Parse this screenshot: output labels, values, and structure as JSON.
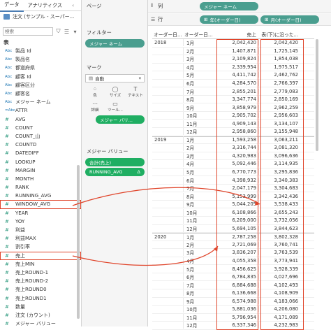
{
  "left": {
    "tabs": [
      "データ",
      "アナリティクス"
    ],
    "collapse": "‹",
    "datasource": "注文 (サンプル - スーパー...",
    "search_placeholder": "検索",
    "tables_title": "表",
    "fields": [
      {
        "type": "Abc",
        "name": "製品 Id"
      },
      {
        "type": "Abc",
        "name": "製品名"
      },
      {
        "type": "Abc",
        "name": "都道府県"
      },
      {
        "type": "Abc",
        "name": "顧客 Id"
      },
      {
        "type": "Abc",
        "name": "顧客区分"
      },
      {
        "type": "Abc",
        "name": "顧客名"
      },
      {
        "type": "Abc",
        "name": "メジャー ネーム"
      },
      {
        "type": "=Abc",
        "name": "ATTR"
      },
      {
        "type": "#",
        "name": "AVG"
      },
      {
        "type": "#",
        "name": "COUNT"
      },
      {
        "type": "#",
        "name": "COUNT_山"
      },
      {
        "type": "#",
        "name": "COUNTD"
      },
      {
        "type": "#",
        "name": "DATEDIFF"
      },
      {
        "type": "#",
        "name": "LOOKUP"
      },
      {
        "type": "#",
        "name": "MARGIN"
      },
      {
        "type": "#",
        "name": "MONTH"
      },
      {
        "type": "#",
        "name": "RANK"
      },
      {
        "type": "#",
        "name": "RUNNING_AVG"
      },
      {
        "type": "#",
        "name": "WINDOW_AVG",
        "highlight": true
      },
      {
        "type": "#",
        "name": "YEAR"
      },
      {
        "type": "#",
        "name": "YOY"
      },
      {
        "type": "#",
        "name": "利益"
      },
      {
        "type": "#",
        "name": "利益MAX"
      },
      {
        "type": "#",
        "name": "割引率"
      },
      {
        "type": "#",
        "name": "売上",
        "highlight": true
      },
      {
        "type": "#",
        "name": "売上MIN"
      },
      {
        "type": "#",
        "name": "売上ROUND-1"
      },
      {
        "type": "#",
        "name": "売上ROUND-2"
      },
      {
        "type": "#",
        "name": "売上ROUND0"
      },
      {
        "type": "#",
        "name": "売上ROUND1"
      },
      {
        "type": "#",
        "name": "数量"
      },
      {
        "type": "#",
        "name": "注文 (カウント)"
      },
      {
        "type": "#",
        "name": "メジャー バリュー"
      }
    ]
  },
  "cards": {
    "pages": "ページ",
    "filters": "フィルター",
    "filter_pill": "メジャー ネーム",
    "marks": "マーク",
    "marks_type": "自動",
    "mark_buttons": [
      {
        "icon": "⁘",
        "label": "色"
      },
      {
        "icon": "◯",
        "label": "サイズ"
      },
      {
        "icon": "T",
        "label": "テキスト"
      },
      {
        "icon": "⋯",
        "label": "詳細"
      },
      {
        "icon": "▭",
        "label": "ツール..."
      }
    ],
    "marks_pill": "メジャー バリ...",
    "measure_values": "メジャー バリュー",
    "mv_pills": [
      "合計(売上)",
      "RUNNING_AVG"
    ],
    "mv_delta": "Δ"
  },
  "main": {
    "columns_label": "列",
    "rows_label": "行",
    "columns_pill": "メジャー ネーム",
    "rows_pills": [
      "年(オーダー日)",
      "月(オーダー日)"
    ],
    "headers": [
      "オーダー日...",
      "オーダー日...",
      "売上",
      "表(下)に沿った..."
    ],
    "years": [
      {
        "year": "2018",
        "rows": [
          [
            "1月",
            "2,042,420",
            "2,042,420"
          ],
          [
            "2月",
            "1,407,871",
            "1,725,145"
          ],
          [
            "3月",
            "2,109,824",
            "1,854,038"
          ],
          [
            "4月",
            "2,339,954",
            "1,975,517"
          ],
          [
            "5月",
            "4,411,742",
            "2,462,762"
          ],
          [
            "6月",
            "4,284,570",
            "2,766,397"
          ],
          [
            "7月",
            "2,855,201",
            "2,779,083"
          ],
          [
            "8月",
            "3,347,774",
            "2,850,169"
          ],
          [
            "9月",
            "3,858,979",
            "2,962,259"
          ],
          [
            "10月",
            "2,905,702",
            "2,956,603"
          ],
          [
            "11月",
            "4,909,143",
            "3,134,107"
          ],
          [
            "12月",
            "2,958,860",
            "3,155,948"
          ]
        ]
      },
      {
        "year": "2019",
        "rows": [
          [
            "1月",
            "1,593,258",
            "3,063,211"
          ],
          [
            "2月",
            "3,316,744",
            "3,081,320"
          ],
          [
            "3月",
            "4,320,983",
            "3,096,636"
          ],
          [
            "4月",
            "5,092,446",
            "3,114,935"
          ],
          [
            "5月",
            "6,770,773",
            "3,295,836"
          ],
          [
            "6月",
            "4,398,932",
            "3,340,383"
          ],
          [
            "7月",
            "2,047,179",
            "3,304,683"
          ],
          [
            "8月",
            "5,153,999",
            "3,342,436"
          ],
          [
            "9月",
            "5,044,205",
            "3,538,433"
          ],
          [
            "10月",
            "6,108,866",
            "3,655,243"
          ],
          [
            "11月",
            "6,209,000",
            "3,732,056"
          ],
          [
            "12月",
            "5,694,105",
            "3,844,623"
          ]
        ]
      },
      {
        "year": "2020",
        "rows": [
          [
            "1月",
            "2,787,258",
            "3,802,328"
          ],
          [
            "2月",
            "2,721,069",
            "3,760,741"
          ],
          [
            "3月",
            "3,836,207",
            "3,763,539"
          ],
          [
            "4月",
            "4,055,358",
            "3,773,941"
          ],
          [
            "5月",
            "8,456,625",
            "3,928,339"
          ],
          [
            "6月",
            "6,784,835",
            "4,027,696"
          ],
          [
            "7月",
            "6,884,688",
            "4,102,493"
          ],
          [
            "8月",
            "6,136,668",
            "4,108,909"
          ],
          [
            "9月",
            "6,574,988",
            "4,183,066"
          ],
          [
            "10月",
            "5,881,036",
            "4,206,080"
          ],
          [
            "11月",
            "5,796,954",
            "4,171,089"
          ],
          [
            "12月",
            "6,337,346",
            "4,232,983"
          ]
        ]
      }
    ]
  },
  "colors": {
    "accent": "#e0452b",
    "pill_teal": "#4a9e8f",
    "pill_green": "#1fae62"
  }
}
